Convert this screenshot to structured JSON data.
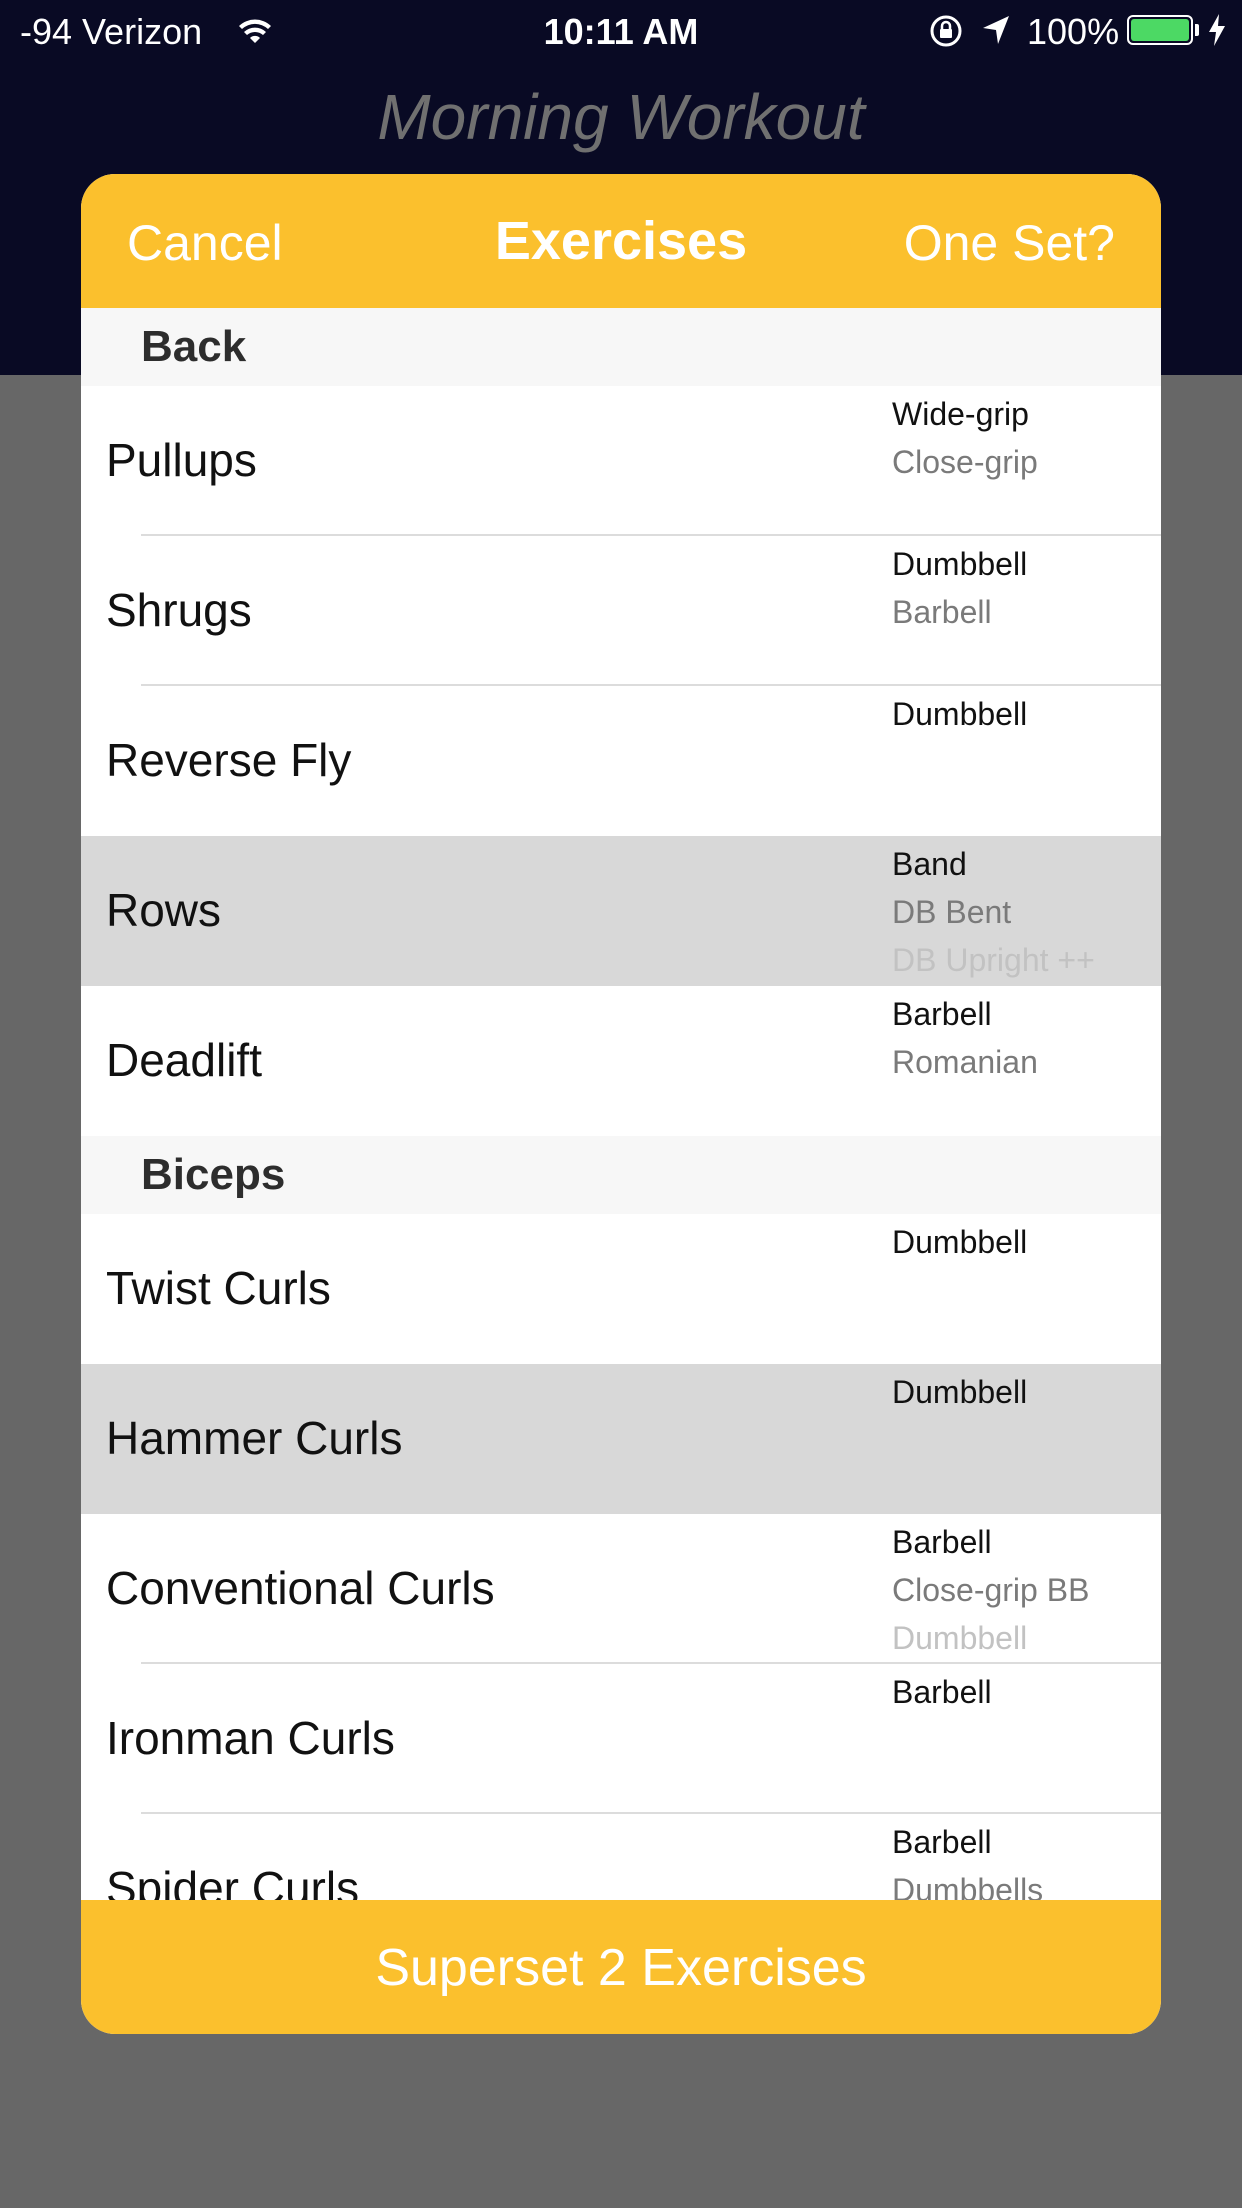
{
  "status_bar": {
    "carrier": "-94 Verizon",
    "time": "10:11 AM",
    "battery": "100%",
    "battery_color": "#4cd964"
  },
  "background": {
    "title": "Morning Workout"
  },
  "modal": {
    "cancel_label": "Cancel",
    "title": "Exercises",
    "one_set_label": "One Set?",
    "footer_label": "Superset 2 Exercises",
    "accent_color": "#fbc02d"
  },
  "sections": [
    {
      "label": "Back",
      "rows": [
        {
          "name": "Pullups",
          "variants": [
            "Wide-grip",
            "Close-grip"
          ],
          "selected": false
        },
        {
          "name": "Shrugs",
          "variants": [
            "Dumbbell",
            "Barbell"
          ],
          "selected": false
        },
        {
          "name": "Reverse Fly",
          "variants": [
            "Dumbbell"
          ],
          "selected": false
        },
        {
          "name": "Rows",
          "variants": [
            "Band",
            "DB Bent",
            "DB Upright ++"
          ],
          "selected": true
        },
        {
          "name": "Deadlift",
          "variants": [
            "Barbell",
            "Romanian"
          ],
          "selected": false
        }
      ]
    },
    {
      "label": "Biceps",
      "rows": [
        {
          "name": "Twist Curls",
          "variants": [
            "Dumbbell"
          ],
          "selected": false
        },
        {
          "name": "Hammer Curls",
          "variants": [
            "Dumbbell"
          ],
          "selected": true
        },
        {
          "name": "Conventional Curls",
          "variants": [
            "Barbell",
            "Close-grip BB",
            "Dumbbell"
          ],
          "selected": false
        },
        {
          "name": "Ironman Curls",
          "variants": [
            "Barbell"
          ],
          "selected": false
        },
        {
          "name": "Spider Curls",
          "variants": [
            "Barbell",
            "Dumbbells"
          ],
          "selected": false
        }
      ]
    }
  ]
}
